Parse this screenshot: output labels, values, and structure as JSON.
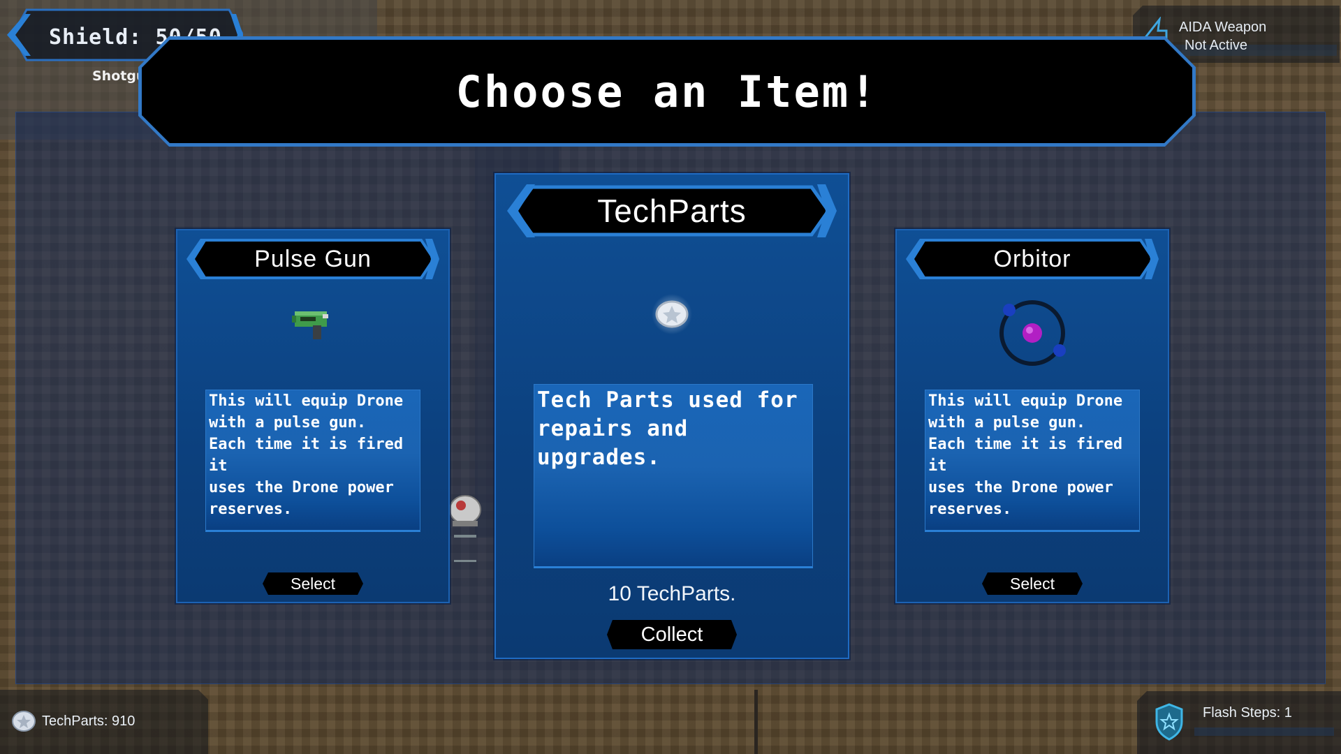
{
  "hud": {
    "shield_text": "Shield: 50/50",
    "weapon_label": "Shotgun",
    "aida_line1": "AIDA Weapon",
    "aida_line2": "Not Active",
    "techparts_text": "TechParts: 910",
    "flash_text": "Flash Steps: 1"
  },
  "dialog": {
    "title": "Choose an Item!"
  },
  "cards": [
    {
      "title": "Pulse Gun",
      "icon": "pulse-gun-icon",
      "description": "This will equip Drone\nwith a pulse gun.\nEach time it is fired it\nuses the Drone power\nreserves.",
      "button_label": "Select"
    },
    {
      "title": "TechParts",
      "icon": "techparts-icon",
      "description": "Tech Parts used for\nrepairs and\nupgrades.",
      "reward": "10 TechParts.",
      "button_label": "Collect"
    },
    {
      "title": "Orbitor",
      "icon": "orbitor-icon",
      "description": "This will equip Drone\nwith a pulse gun.\nEach time it is fired it\nuses the Drone power\nreserves.",
      "button_label": "Select"
    }
  ],
  "colors": {
    "accent_blue": "#2a80d6",
    "card_blue": "#0f4f95",
    "banner_black": "#000000"
  }
}
